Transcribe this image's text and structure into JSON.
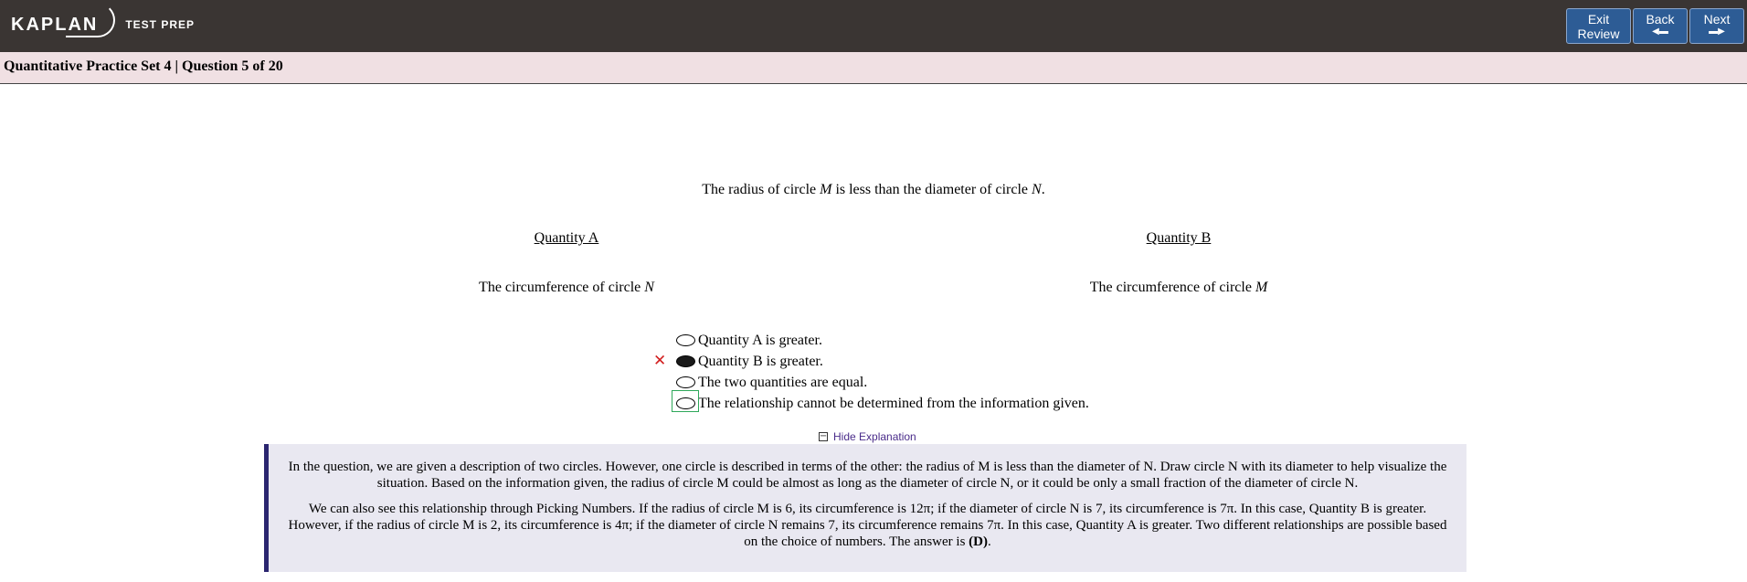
{
  "header": {
    "logo_main": "KAPLAN",
    "logo_sub": "TEST PREP",
    "buttons": {
      "exit_line1": "Exit",
      "exit_line2": "Review",
      "back": "Back",
      "next": "Next"
    }
  },
  "subheader": {
    "title": "Quantitative Practice Set 4 | Question 5 of 20"
  },
  "question": {
    "stem_pre": "The radius of circle ",
    "stem_var1": "M",
    "stem_mid": " is less than the diameter of circle ",
    "stem_var2": "N",
    "stem_end": ".",
    "quantity_a_label": "Quantity A",
    "quantity_b_label": "Quantity B",
    "quantity_a_text": "The circumference of circle ",
    "quantity_a_var": "N",
    "quantity_b_text": "The circumference of circle ",
    "quantity_b_var": "M",
    "choices": [
      {
        "label": "Quantity A is greater.",
        "selected": false
      },
      {
        "label": "Quantity B is greater.",
        "selected": true,
        "marked_wrong": true
      },
      {
        "label": "The two quantities are equal.",
        "selected": false
      },
      {
        "label": "The relationship cannot be determined from the information given.",
        "selected": false,
        "correct": true
      }
    ]
  },
  "explanation": {
    "toggle_label": "Hide Explanation",
    "p1": "In the question, we are given a description of two circles. However, one circle is described in terms of the other: the radius of M is less than the diameter of N. Draw circle N with its diameter to help visualize the situation. Based on the information given, the radius of circle M could be almost as long as the diameter of circle N, or it could be only a small fraction of the diameter of circle N.",
    "p2_pre": "We can also see this relationship through Picking Numbers. If the radius of circle M is 6, its circumference is 12π; if the diameter of circle N is 7, its circumference is 7π. In this case, Quantity B is greater. However, if the radius of circle M is 2, its circumference is 4π; if the diameter of circle N remains 7, its circumference remains 7π. In this case, Quantity A is greater. Two different relationships are possible based on the choice of numbers. The answer is ",
    "p2_answer": "(D)",
    "p2_end": "."
  },
  "colors": {
    "topbar": "#3a3533",
    "button": "#2d5c95",
    "subbar": "#f0e0e3",
    "explanation_bg": "#e9e8f1",
    "explanation_border": "#2b2670",
    "wrong": "#d21f1f",
    "correct": "#2fa85a"
  }
}
